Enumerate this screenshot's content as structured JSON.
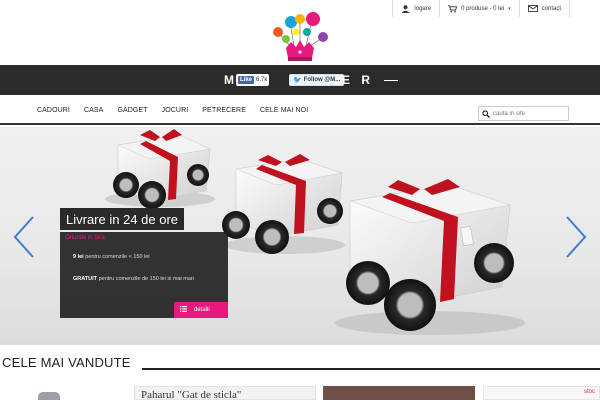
{
  "topbar": {
    "login_label": "logare",
    "cart_label": "0 produse - 0 lei",
    "contact_label": "contact"
  },
  "header": {
    "brand_left": "M",
    "brand_right": "E R",
    "facebook": {
      "like_label": "Like",
      "count": "6.7k"
    },
    "twitter": {
      "follow_label": "Follow @M..."
    }
  },
  "nav": {
    "items": [
      "CADOURI",
      "CASA",
      "GADGET",
      "JOCURI",
      "PETRECERE",
      "CELE MAI NOI"
    ],
    "search_placeholder": "cauta in site"
  },
  "hero": {
    "title": "Livrare in 24 de ore",
    "subtitle": "Oriunde in tara",
    "line1_bold": "9 lei",
    "line1_text": " pentru comenzile < 150 lei",
    "line2_bold": "GRATUIT",
    "line2_text": " pentru comenzile de 150 lei si mai mari",
    "button_label": "detalii"
  },
  "section": {
    "title": "CELE MAI VANDUTE",
    "product2_title": "Paharul \"Gat de sticla\"",
    "product4_badge": "stoc"
  },
  "colors": {
    "accent": "#e8197d",
    "dark_bar": "#2b2b2b",
    "arrow": "#3d7fd0"
  }
}
